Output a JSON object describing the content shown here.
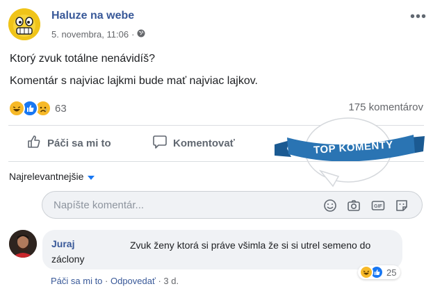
{
  "post": {
    "page_name": "Haluze na webe",
    "timestamp": "5. novembra, 11:06",
    "privacy_icon": "globe-icon",
    "more_label": "•••",
    "text_line1": "Ktorý zvuk totálne nenávidíš?",
    "text_line2": "Komentár s najviac lajkmi bude mať najviac lajkov.",
    "reactions": [
      "haha",
      "like",
      "sad"
    ],
    "reaction_count": "63",
    "comment_count": "175 komentárov"
  },
  "actions": {
    "like_label": "Páči sa mi to",
    "comment_label": "Komentovať"
  },
  "badge": {
    "label": "TOP KOMENTY",
    "color": "#2a74b3"
  },
  "comments_section": {
    "sort_label": "Najrelevantnejšie",
    "input_placeholder": "Napíšte komentár...",
    "composer_icons": [
      "emoji-icon",
      "camera-icon",
      "gif-icon",
      "sticker-icon"
    ]
  },
  "comment": {
    "author": "Juraj",
    "text": "Zvuk ženy ktorá si práve všimla že si si utrel semeno do záclony",
    "reactions": [
      "haha",
      "like"
    ],
    "reaction_count": "25",
    "like_label": "Páči sa mi to",
    "separator": " · ",
    "reply_label": "Odpovedať",
    "time": "3 d."
  },
  "colors": {
    "link": "#385898",
    "like_blue": "#1877f2",
    "haha_yellow": "#f7b928",
    "muted": "#65676b"
  }
}
